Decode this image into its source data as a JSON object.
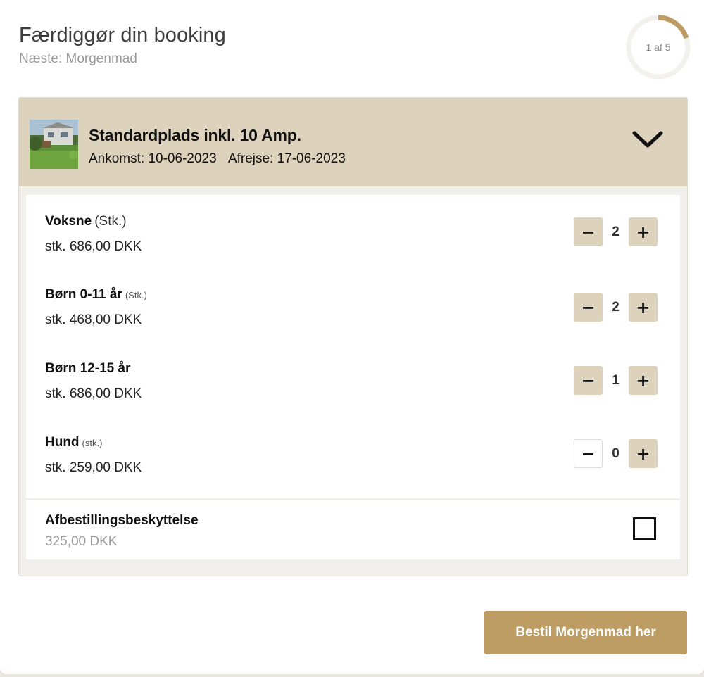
{
  "header": {
    "title": "Færdiggør din booking",
    "subtitle": "Næste: Morgenmad",
    "progress_text": "1 af 5",
    "progress_fraction": 0.2
  },
  "booking": {
    "site_name": "Standardplads inkl. 10 Amp.",
    "arrival": "Ankomst: 10-06-2023",
    "departure": "Afrejse: 17-06-2023",
    "thumbnail_icon": "campsite-photo",
    "toggle_icon": "chevron-down-icon"
  },
  "items": [
    {
      "name": "Voksne",
      "unit": "(Stk.)",
      "price": "stk. 686,00 DKK",
      "quantity": "2"
    },
    {
      "name": "Børn 0-11 år",
      "unit": "(Stk.)",
      "price": "stk. 468,00 DKK",
      "quantity": "2"
    },
    {
      "name": "Børn 12-15 år",
      "unit": "",
      "price": "stk. 686,00 DKK",
      "quantity": "1"
    },
    {
      "name": "Hund",
      "unit": "(stk.)",
      "price": "stk. 259,00 DKK",
      "quantity": "0"
    }
  ],
  "stepper": {
    "minus": "−",
    "plus": "+"
  },
  "insurance": {
    "title": "Afbestillingsbeskyttelse",
    "price": "325,00 DKK",
    "checked": false
  },
  "cta": {
    "label": "Bestil Morgenmad her"
  },
  "colors": {
    "accent": "#bd9c63",
    "header_bg": "#ddd2bc",
    "card_bg": "#f0efec"
  }
}
